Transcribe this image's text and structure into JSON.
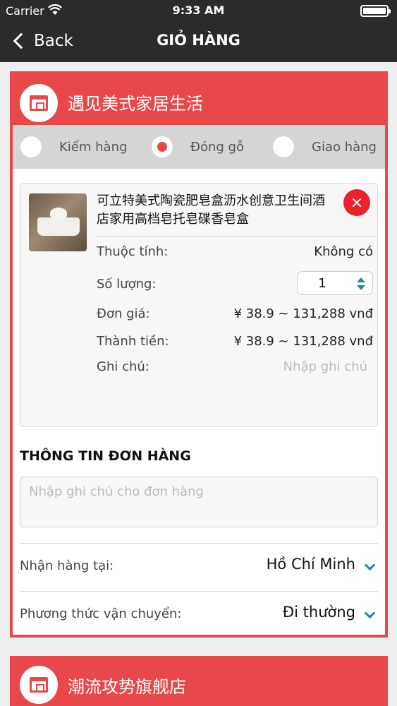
{
  "status_bar": {
    "carrier": "Carrier",
    "time": "9:33 AM"
  },
  "nav": {
    "back_label": "Back",
    "title": "GIỎ HÀNG"
  },
  "shops": [
    {
      "name": "遇见美式家居生活",
      "options": [
        {
          "label": "Kiểm hàng",
          "selected": false
        },
        {
          "label": "Đóng gỗ",
          "selected": true
        },
        {
          "label": "Giao hàng",
          "selected": false
        }
      ],
      "product": {
        "name": "可立特美式陶瓷肥皂盒沥水创意卫生间酒店家用高档皂托皂碟香皂盒",
        "attribute_label": "Thuộc tính:",
        "attribute_value": "Không có",
        "quantity_label": "Số lượng:",
        "quantity_value": "1",
        "unit_price_label": "Đơn giá:",
        "unit_price_value": "¥ 38.9 ~ 131,288 vnđ",
        "total_label": "Thành tiền:",
        "total_value": "¥ 38.9 ~ 131,288 vnđ",
        "note_label": "Ghi chú:",
        "note_placeholder": "Nhập ghi chú"
      },
      "order_info": {
        "title": "THÔNG TIN ĐƠN HÀNG",
        "note_placeholder": "Nhập ghi chú cho đơn hàng",
        "receive_label": "Nhận hàng tại:",
        "receive_value": "Hồ Chí Minh",
        "shipping_label": "Phương thức vận chuyển:",
        "shipping_value": "Đi thường"
      }
    },
    {
      "name": "潮流攻势旗舰店"
    }
  ],
  "colors": {
    "accent": "#e9484a",
    "nav_bg": "#2b2b2b",
    "teal": "#2a8a93",
    "remove": "#e8232e"
  }
}
